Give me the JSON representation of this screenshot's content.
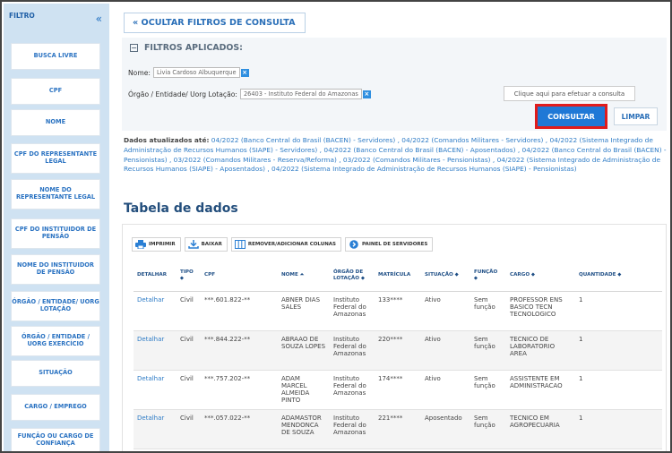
{
  "sidebar": {
    "title": "FILTRO",
    "toggle": "«",
    "items": [
      {
        "label": "BUSCA LIVRE"
      },
      {
        "label": "CPF"
      },
      {
        "label": "NOME"
      },
      {
        "label": "CPF DO REPRESENTANTE LEGAL"
      },
      {
        "label": "NOME DO REPRESENTANTE LEGAL"
      },
      {
        "label": "CPF DO INSTITUIDOR DE PENSÃO"
      },
      {
        "label": "NOME DO INSTITUIDOR DE PENSÃO"
      },
      {
        "label": "ÓRGÃO / ENTIDADE/ UORG LOTAÇÃO"
      },
      {
        "label": "ÓRGÃO / ENTIDADE / UORG EXERCÍCIO"
      },
      {
        "label": "SITUAÇÃO"
      },
      {
        "label": "CARGO / EMPREGO"
      },
      {
        "label": "FUNÇÃO OU CARGO DE CONFIANÇA"
      }
    ]
  },
  "hide_filters": "« OCULTAR FILTROS DE CONSULTA",
  "filters": {
    "heading": "FILTROS APLICADOS:",
    "name_label": "Nome:",
    "name_value": "Livia Cardoso Albuquerque",
    "orgao_label": "Órgão / Entidade/ Uorg Lotação:",
    "orgao_value": "26403 - Instituto Federal do Amazonas",
    "remove_glyph": "×",
    "hint": "Clique aqui para efetuar a consulta",
    "consultar": "CONSULTAR",
    "limpar": "LIMPAR"
  },
  "updated": {
    "label": "Dados atualizados até:",
    "text": "04/2022 (Banco Central do Brasil (BACEN) - Servidores) , 04/2022 (Comandos Militares - Servidores) , 04/2022 (Sistema Integrado de Administração de Recursos Humanos (SIAPE) - Servidores) , 04/2022 (Banco Central do Brasil (BACEN) - Aposentados) , 04/2022 (Banco Central do Brasil (BACEN) - Pensionistas) , 03/2022 (Comandos Militares - Reserva/Reforma) , 03/2022 (Comandos Militares - Pensionistas) , 04/2022 (Sistema Integrado de Administração de Recursos Humanos (SIAPE) - Aposentados) , 04/2022 (Sistema Integrado de Administração de Recursos Humanos (SIAPE) - Pensionistas)"
  },
  "table_title": "Tabela de dados",
  "toolbar": {
    "print": "IMPRIMIR",
    "download": "BAIXAR",
    "columns": "REMOVER/ADICIONAR COLUNAS",
    "panel": "PAINEL DE SERVIDORES"
  },
  "table": {
    "headers": [
      "DETALHAR",
      "TIPO ⬥",
      "CPF",
      "NOME ⏶",
      "ÓRGÃO DE LOTAÇÃO ⬥",
      "MATRÍCULA",
      "SITUAÇÃO ⬥",
      "FUNÇÃO ⬥",
      "CARGO ⬥",
      "QUANTIDADE ⬥"
    ],
    "rows": [
      [
        "Detalhar",
        "Civil",
        "***.601.822-**",
        "ABNER DIAS SALES",
        "Instituto Federal do Amazonas",
        "133****",
        "Ativo",
        "Sem função",
        "PROFESSOR ENS BASICO TECN TECNOLOGICO",
        "1"
      ],
      [
        "Detalhar",
        "Civil",
        "***.844.222-**",
        "ABRAAO DE SOUZA LOPES",
        "Instituto Federal do Amazonas",
        "220****",
        "Ativo",
        "Sem função",
        "TECNICO DE LABORATORIO AREA",
        "1"
      ],
      [
        "Detalhar",
        "Civil",
        "***.757.202-**",
        "ADAM MARCEL ALMEIDA PINTO",
        "Instituto Federal do Amazonas",
        "174****",
        "Ativo",
        "Sem função",
        "ASSISTENTE EM ADMINISTRACAO",
        "1"
      ],
      [
        "Detalhar",
        "Civil",
        "***.057.022-**",
        "ADAMASTOR MENDONCA DE SOUZA",
        "Instituto Federal do Amazonas",
        "221****",
        "Aposentado",
        "Sem função",
        "TECNICO EM AGROPECUARIA",
        "1"
      ]
    ]
  },
  "colors": {
    "accent": "#1f78d6",
    "highlight": "#e01b1b",
    "sidebar_bg": "#cfe2f2"
  }
}
